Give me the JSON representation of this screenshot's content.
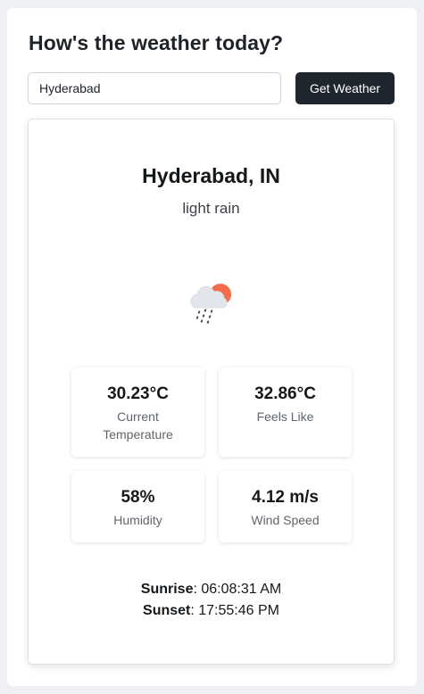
{
  "header": {
    "title": "How's the weather today?"
  },
  "search": {
    "value": "Hyderabad",
    "button_label": "Get Weather"
  },
  "weather": {
    "location": "Hyderabad, IN",
    "condition": "light rain",
    "icon": "cloud-rain-sun-icon",
    "stats": [
      {
        "value": "30.23°C",
        "label": "Current Temperature"
      },
      {
        "value": "32.86°C",
        "label": "Feels Like"
      },
      {
        "value": "58%",
        "label": "Humidity"
      },
      {
        "value": "4.12 m/s",
        "label": "Wind Speed"
      }
    ],
    "sunrise_label": "Sunrise",
    "sunrise_value": ": 06:08:31 AM",
    "sunset_label": "Sunset",
    "sunset_value": ": 17:55:46 PM"
  },
  "colors": {
    "page_background": "#eef0f3",
    "button_background": "#1f262e",
    "sun": "#f26d4b",
    "cloud": "#e3e6ea"
  }
}
